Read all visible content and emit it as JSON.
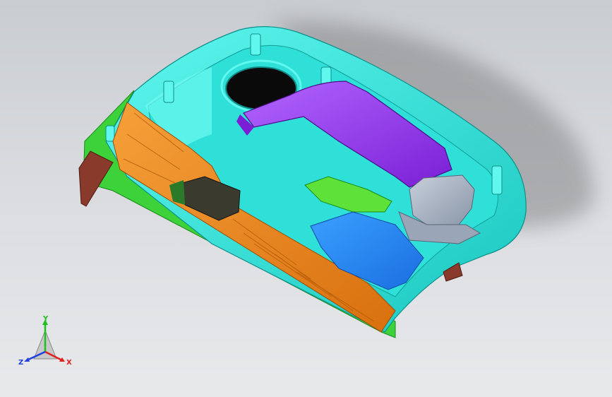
{
  "viewport": {
    "background_top": "#c9ccd1",
    "background_bottom": "#e8e9eb"
  },
  "model": {
    "colors": {
      "shell": "#33f0e6",
      "shell_dark": "#1fc7c0",
      "orange_panel": "#f08a1e",
      "purple_cover": "#9a3ef0",
      "blue_plate": "#2a8cf0",
      "green_rim": "#3ed23a",
      "gray_block": "#aab4c4",
      "dark_component": "#3a3a2e",
      "brown_part": "#8a3a2a"
    }
  },
  "triad": {
    "x_label": "X",
    "y_label": "Y",
    "z_label": "Z",
    "x_color": "#e02020",
    "y_color": "#20c020",
    "z_color": "#2040e0"
  }
}
